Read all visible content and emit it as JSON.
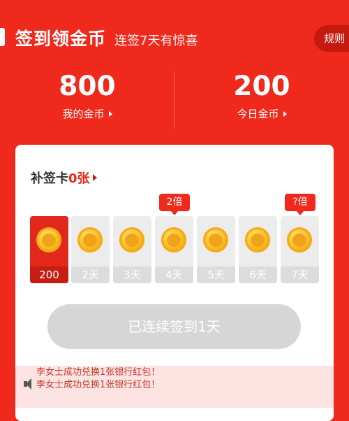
{
  "header": {
    "title": "签到领金币",
    "subtitle": "连签7天有惊喜",
    "rules_label": "规则"
  },
  "stats": {
    "my_coins_value": "800",
    "my_coins_label": "我的金币",
    "today_value": "200",
    "today_label": "今日金币"
  },
  "card": {
    "supplement_prefix": "补签卡",
    "supplement_count": "0张",
    "days": [
      {
        "label": "200",
        "active": true
      },
      {
        "label": "2天",
        "active": false
      },
      {
        "label": "3天",
        "active": false
      },
      {
        "label": "4天",
        "active": false,
        "badge": "2倍"
      },
      {
        "label": "5天",
        "active": false
      },
      {
        "label": "6天",
        "active": false
      },
      {
        "label": "7天",
        "active": false,
        "badge": "?倍"
      }
    ],
    "checkin_button": "已连续签到1天"
  },
  "ticker": {
    "line1": "李女士成功兑换1张银行红包！",
    "line2": "李女士成功兑换1张银行红包！"
  },
  "colors": {
    "brand": "#ef2a1c",
    "active_day": "#e2281c",
    "disabled": "#d6d6d6"
  }
}
